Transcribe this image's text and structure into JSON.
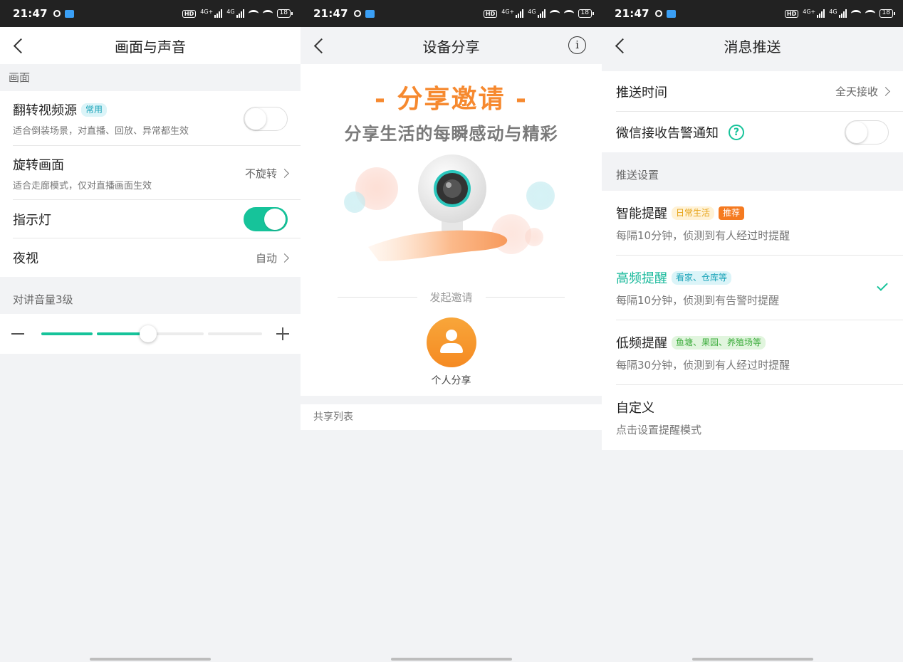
{
  "status": {
    "time": "21:47",
    "hd": "HD",
    "sig1": "4G+",
    "sig2": "4G",
    "battery": "18"
  },
  "colors": {
    "accent": "#16c39a",
    "orange": "#f58a22",
    "dark_bar": "#222222"
  },
  "screen1": {
    "title": "画面与声音",
    "section_video": "画面",
    "flip": {
      "label": "翻转视频源",
      "tag": "常用",
      "desc": "适合倒装场景，对直播、回放、异常都生效",
      "toggle_on": false
    },
    "rotate": {
      "label": "旋转画面",
      "desc": "适合走廊模式，仅对直播画面生效",
      "value": "不旋转"
    },
    "indicator": {
      "label": "指示灯",
      "toggle_on": true
    },
    "night": {
      "label": "夜视",
      "value": "自动"
    },
    "volume_label": "对讲音量3级",
    "volume": {
      "level": 3,
      "max": 5
    }
  },
  "screen2": {
    "title": "设备分享",
    "banner_title": "- 分享邀请 -",
    "banner_sub": "分享生活的每瞬感动与精彩",
    "invite_label": "发起邀请",
    "personal_share": "个人分享",
    "share_list": "共享列表"
  },
  "screen3": {
    "title": "消息推送",
    "push_time": {
      "label": "推送时间",
      "value": "全天接收"
    },
    "wechat": {
      "label": "微信接收告警通知",
      "help": "?",
      "toggle_on": false
    },
    "section_label": "推送设置",
    "modes": [
      {
        "label": "智能提醒",
        "tags": [
          "日常生活",
          "推荐"
        ],
        "desc": "每隔10分钟，侦测到有人经过时提醒",
        "selected": false
      },
      {
        "label": "高频提醒",
        "tags": [
          "看家、仓库等"
        ],
        "desc": "每隔10分钟，侦测到有告警时提醒",
        "selected": true
      },
      {
        "label": "低频提醒",
        "tags": [
          "鱼塘、果园、养殖场等"
        ],
        "desc": "每隔30分钟，侦测到有人经过时提醒",
        "selected": false
      },
      {
        "label": "自定义",
        "tags": [],
        "desc": "点击设置提醒模式",
        "selected": false
      }
    ]
  }
}
